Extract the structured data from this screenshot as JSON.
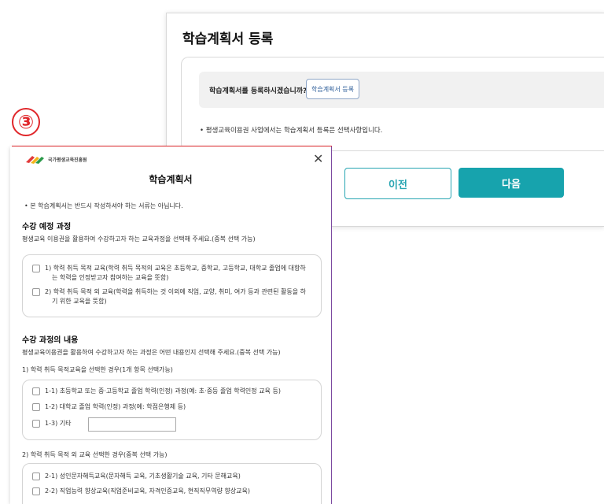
{
  "background_page": {
    "title": "학습계획서 등록",
    "question": "학습계획서를 등록하시겠습니까?",
    "register_button": "학습계획서 등록",
    "note": "• 평생교육이용권 사업에서는 학습계획서 등록은 선택사항입니다.",
    "prev_button": "이전",
    "next_button": "다음"
  },
  "step_marker": "③",
  "modal": {
    "logo_text": "국가평생교육진흥원",
    "close_icon": "close-icon",
    "title": "학습계획서",
    "note": "• 본 학습계획서는 반드시 작성하셔야 하는 서류는 아닙니다.",
    "section1": {
      "title": "수강 예정 과정",
      "desc": "평생교육 이용권을 활용하여 수강하고자 하는 교육과정을 선택해 주세요.(중복 선택 가능)",
      "options": [
        {
          "line1": "1) 학력 취득 목적 교육(학력 취득 목적의 교육은 초등학교, 중학교, 고등학교, 대학교 졸업에 대항하",
          "line2": "는 학력을 인정받고자 참여하는 교육을 뜻함)"
        },
        {
          "line1": "2) 학력 취득 목적 외 교육(학력을 취득하는 것 이외에 직업, 교양, 취미, 여가 등과 관련된 활동을 하",
          "line2": "기 위한 교육을 뜻함)"
        }
      ]
    },
    "section2": {
      "title": "수강 과정의 내용",
      "desc": "평생교육이용권을 활용하여 수강하고자 하는 과정은 어떤 내용인지 선택해 주세요.(중복 선택 가능)",
      "group1_label": "1) 학력 취득 목적교육을 선택한 경우(1개 항목 선택가능)",
      "group1_options": [
        "1-1) 초등학교 또는 중·고등학교 졸업 학력(인정) 과정(예: 초·중등 졸업 학력인정 교육 등)",
        "1-2) 대학교 졸업 학력(인정) 과정(예: 학점은행제 등)",
        "1-3) 기타"
      ],
      "etc_value": "",
      "group2_label": "2) 학력 취득 목적 외 교육 선택한 경우(중복 선택 가능)",
      "group2_options": [
        "2-1) 성인문자해득교육(문자해득 교육, 기초생활기술 교육, 기타 문해교육)",
        "2-2) 직업능력 향상교육(직업준비교육, 자격인증교육, 현직직무역량 향상교육)"
      ]
    }
  },
  "colors": {
    "accent": "#17a3ad",
    "marker": "#e0262a",
    "border_purple": "#7c4aa0"
  }
}
